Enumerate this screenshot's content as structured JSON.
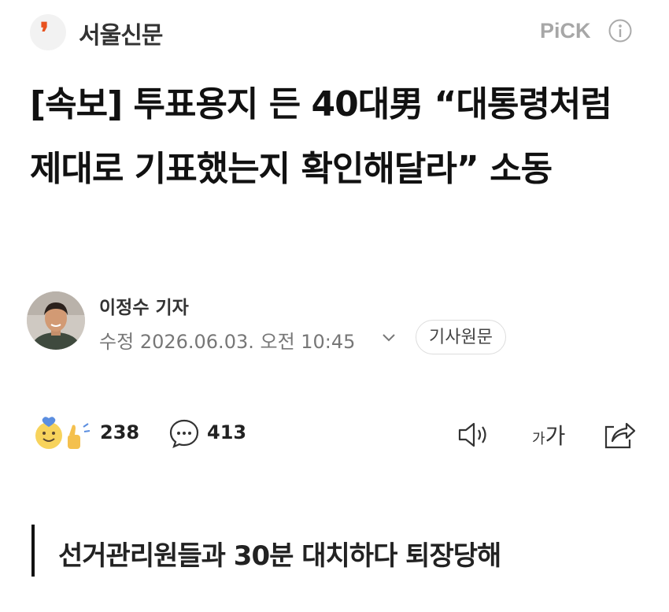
{
  "header": {
    "press_logo_glyph": "❜",
    "press_name": "서울신문",
    "pick_label": "PiCK"
  },
  "article": {
    "headline": "[속보] 투표용지 든 40대男 “대통령처럼 제대로 기표했는지 확인해달라” 소동",
    "reporter": "이정수 기자",
    "edited_label": "수정",
    "datetime": "2026.06.03. 오전 10:45",
    "original_button": "기사원문",
    "subheading": "선거관리원들과 30분 대치하다 퇴장당해"
  },
  "toolbar": {
    "reaction_count": "238",
    "comment_count": "413",
    "font_size_small": "가",
    "font_size_large": "가"
  },
  "colors": {
    "brand_accent": "#e8521f",
    "text_primary": "#111111",
    "text_muted": "#777777",
    "pick_gray": "#a7a7a7"
  },
  "icons": {
    "press_logo": "press-logo-icon",
    "info": "info-icon",
    "chevron": "chevron-down-icon",
    "reaction": "reaction-emoji-icon",
    "comment": "comment-icon",
    "speaker": "speaker-icon",
    "share": "share-icon"
  }
}
